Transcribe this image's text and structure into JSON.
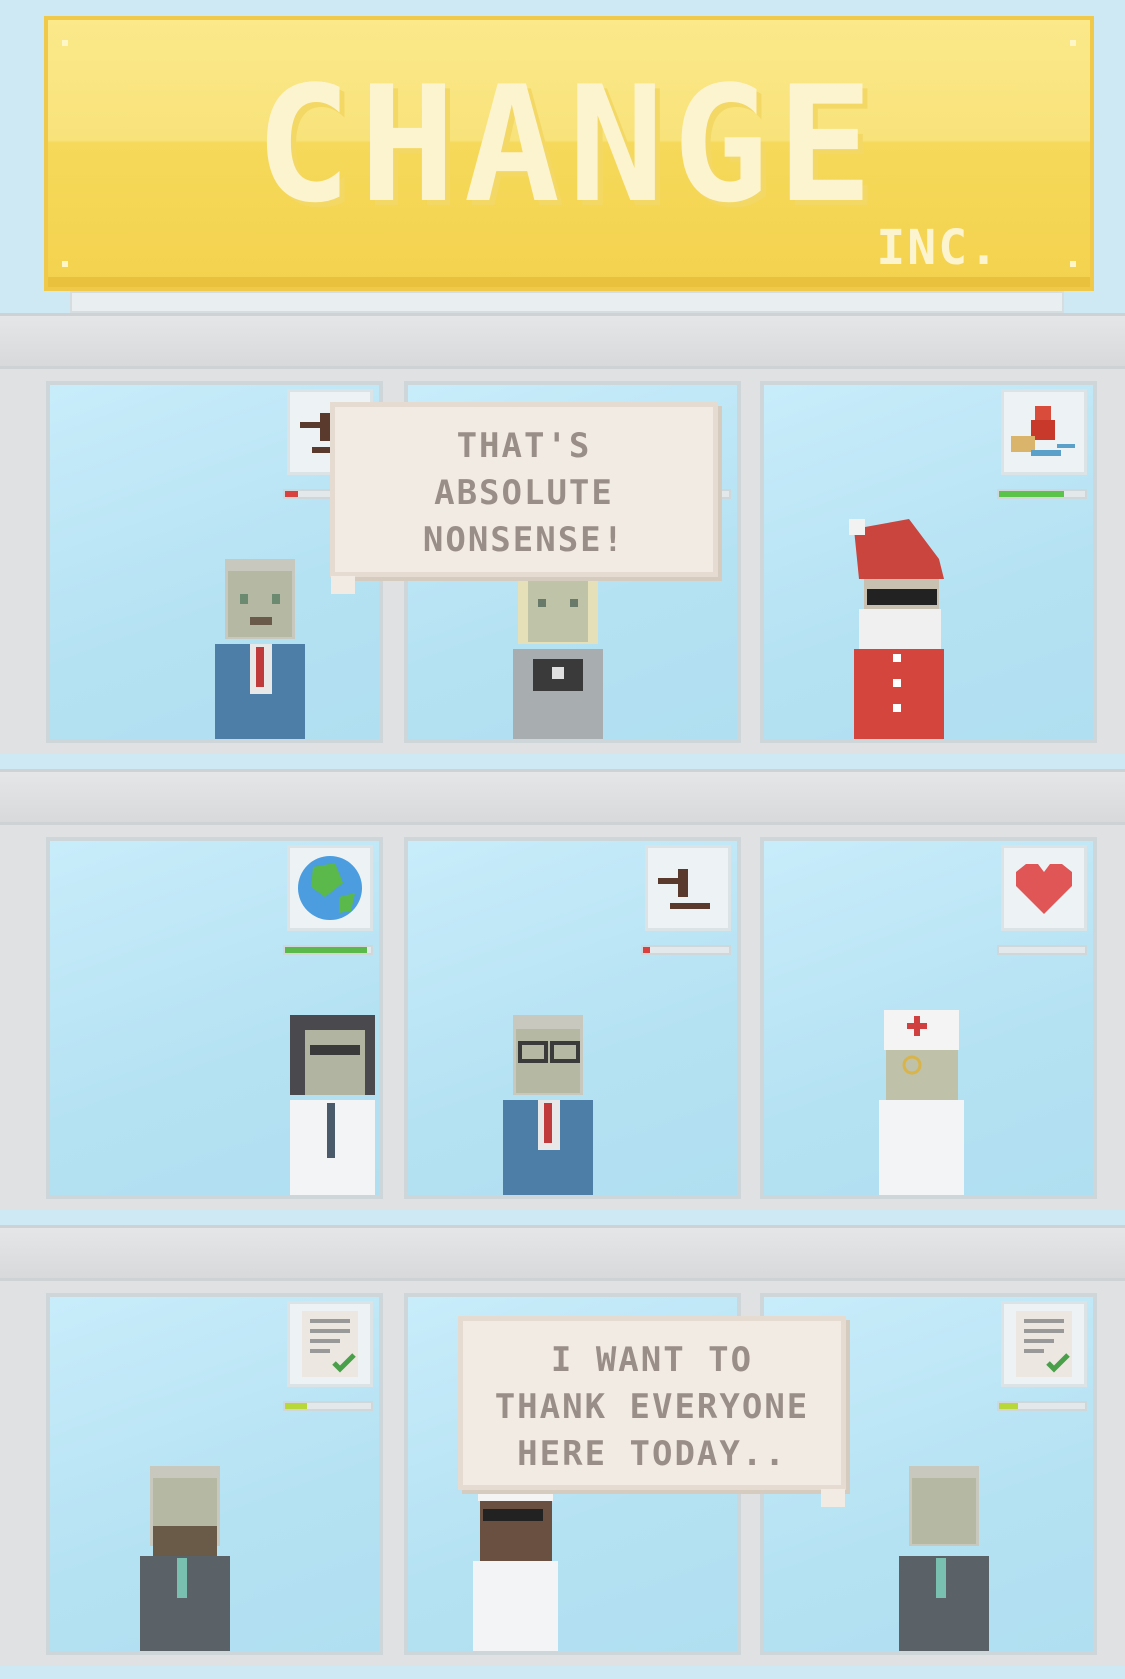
{
  "sign": {
    "title": "CHANGE",
    "subtitle": "INC."
  },
  "bubbles": [
    {
      "text": "THAT'S ABSOLUTE NONSENSE!"
    },
    {
      "text": "I WANT TO THANK EVERYONE HERE TODAY.."
    }
  ],
  "offices": [
    {
      "icon": "gavel-icon",
      "meter": 0.15,
      "meter_color": "#d94040",
      "character": "gray-haired businessman in blue suit"
    },
    {
      "icon": "hidden",
      "meter": 0.1,
      "meter_color": "#6cc04a",
      "character": "blonde woman with camera"
    },
    {
      "icon": "santa-sleigh-icon",
      "meter": 0.75,
      "meter_color": "#5bc24a",
      "character": "santa claus with sunglasses"
    },
    {
      "icon": "globe-icon",
      "meter": 0.95,
      "meter_color": "#5bb84a",
      "character": "dark-haired woman in white uniform"
    },
    {
      "icon": "gavel-icon",
      "meter": 0.08,
      "meter_color": "#d94040",
      "character": "bald businessman with glasses"
    },
    {
      "icon": "heart-icon",
      "meter": 0.0,
      "meter_color": "#cccccc",
      "character": "nurse with monocle"
    },
    {
      "icon": "checklist-icon",
      "meter": 0.25,
      "meter_color": "#b8d83a",
      "character": "bearded man in gray suit"
    },
    {
      "icon": "hidden",
      "meter": 0.0,
      "meter_color": "#cccccc",
      "character": "doctor with sunglasses"
    },
    {
      "icon": "checklist-icon",
      "meter": 0.22,
      "meter_color": "#b8d83a",
      "character": "old man in gray suit"
    }
  ]
}
